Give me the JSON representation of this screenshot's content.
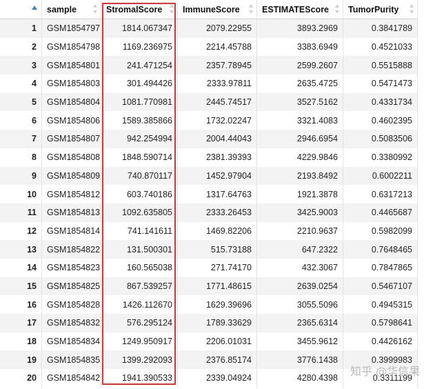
{
  "columns": [
    "",
    "sample",
    "StromalScore",
    "ImmuneScore",
    "ESTIMATEScore",
    "TumorPurity"
  ],
  "rows": [
    [
      "1",
      "GSM1854797",
      "1814.067347",
      "2079.22955",
      "3893.2969",
      "0.3841789"
    ],
    [
      "2",
      "GSM1854798",
      "1169.236975",
      "2214.45788",
      "3383.6949",
      "0.4521033"
    ],
    [
      "3",
      "GSM1854801",
      "241.471254",
      "2357.78945",
      "2599.2607",
      "0.5515888"
    ],
    [
      "4",
      "GSM1854803",
      "301.494426",
      "2333.97811",
      "2635.4725",
      "0.5471473"
    ],
    [
      "5",
      "GSM1854804",
      "1081.770981",
      "2445.74517",
      "3527.5162",
      "0.4331734"
    ],
    [
      "6",
      "GSM1854806",
      "1589.385866",
      "1732.02247",
      "3321.4083",
      "0.4602395"
    ],
    [
      "7",
      "GSM1854807",
      "942.254994",
      "2004.44043",
      "2946.6954",
      "0.5083506"
    ],
    [
      "8",
      "GSM1854808",
      "1848.590714",
      "2381.39393",
      "4229.9846",
      "0.3380992"
    ],
    [
      "9",
      "GSM1854809",
      "740.870117",
      "1452.97904",
      "2193.8492",
      "0.6002211"
    ],
    [
      "10",
      "GSM1854812",
      "603.740186",
      "1317.64763",
      "1921.3878",
      "0.6317213"
    ],
    [
      "11",
      "GSM1854813",
      "1092.635805",
      "2333.26453",
      "3425.9003",
      "0.4465687"
    ],
    [
      "12",
      "GSM1854814",
      "741.141611",
      "1469.82206",
      "2210.9637",
      "0.5982099"
    ],
    [
      "13",
      "GSM1854822",
      "131.500301",
      "515.73188",
      "647.2322",
      "0.7648465"
    ],
    [
      "14",
      "GSM1854823",
      "160.565038",
      "271.74170",
      "432.3067",
      "0.7847865"
    ],
    [
      "15",
      "GSM1854825",
      "867.539257",
      "1771.48615",
      "2639.0254",
      "0.5467107"
    ],
    [
      "16",
      "GSM1854828",
      "1426.112670",
      "1629.39696",
      "3055.5096",
      "0.4945315"
    ],
    [
      "17",
      "GSM1854832",
      "576.295124",
      "1789.33629",
      "2365.6314",
      "0.5798641"
    ],
    [
      "18",
      "GSM1854834",
      "1249.950917",
      "2206.01031",
      "3455.9612",
      "0.4426162"
    ],
    [
      "19",
      "GSM1854835",
      "1399.292093",
      "2376.85174",
      "3776.1438",
      "0.3999983"
    ],
    [
      "20",
      "GSM1854842",
      "1941.390533",
      "2339.04924",
      "4280.4398",
      "0.3311199"
    ]
  ],
  "highlight_color": "#e53030",
  "sort_indicator_color": "#2a8ad8",
  "watermark": "知乎 @华信果"
}
